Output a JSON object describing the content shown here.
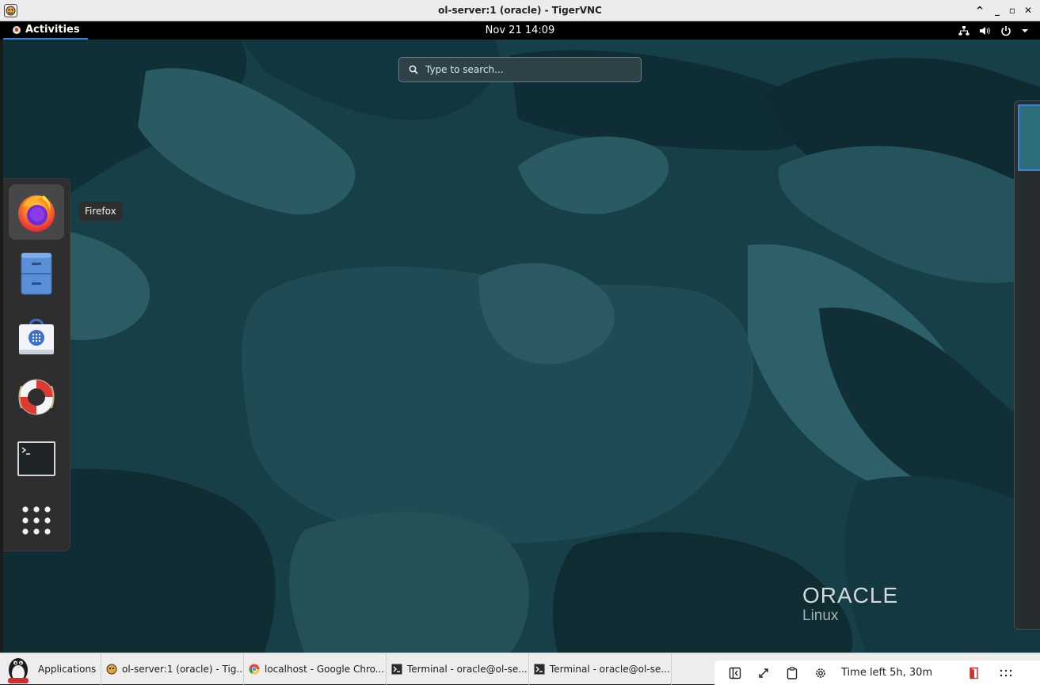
{
  "vnc_window": {
    "title": "ol-server:1 (oracle) - TigerVNC",
    "controls": {
      "up": "^",
      "minimize": "_",
      "maximize": "▫",
      "close": "✕"
    }
  },
  "gnome_topbar": {
    "activities_label": "Activities",
    "clock": "Nov 21  14:09",
    "status_icons": [
      "network-icon",
      "volume-icon",
      "power-icon",
      "chevron-down-icon"
    ]
  },
  "overview": {
    "search_placeholder": "Type to search...",
    "tooltip": "Firefox",
    "dash_items": [
      {
        "name": "Firefox",
        "icon": "firefox-icon"
      },
      {
        "name": "Files",
        "icon": "file-cabinet-icon"
      },
      {
        "name": "Software",
        "icon": "software-bag-icon"
      },
      {
        "name": "Help",
        "icon": "lifebuoy-icon"
      },
      {
        "name": "Terminal",
        "icon": "terminal-icon"
      },
      {
        "name": "Show Applications",
        "icon": "app-grid-icon"
      }
    ],
    "branding": {
      "word": "ORACLE",
      "sub": "Linux"
    }
  },
  "taskbar": {
    "applications_label": "Applications",
    "tasks": [
      {
        "label": "ol-server:1 (oracle) - Tig...",
        "icon": "tigervnc-icon"
      },
      {
        "label": "localhost - Google Chro...",
        "icon": "chrome-icon"
      },
      {
        "label": "Terminal - oracle@ol-se...",
        "icon": "terminal-icon"
      },
      {
        "label": "Terminal - oracle@ol-se...",
        "icon": "terminal-icon"
      }
    ],
    "tray": {
      "time_left": "Time left 5h, 30m",
      "icons": [
        "sidebar-toggle-icon",
        "fullscreen-icon",
        "clipboard-icon",
        "settings-gear-icon",
        "exit-door-icon",
        "more-menu-icon"
      ]
    }
  },
  "colors": {
    "desktop_bg": "#153a41",
    "accent": "#3584e4",
    "topbar": "#000000"
  }
}
